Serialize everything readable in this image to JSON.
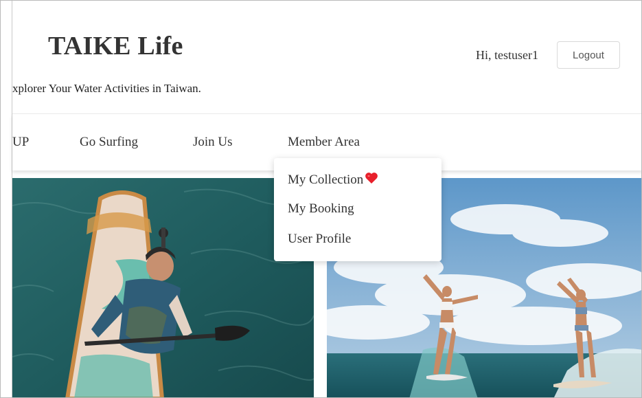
{
  "header": {
    "brand": "TAIKE Life",
    "tagline": "xplorer Your Water Activities in Taiwan.",
    "greeting": "Hi, testuser1",
    "logout_label": "Logout"
  },
  "nav": {
    "items": [
      {
        "label": "UP"
      },
      {
        "label": "Go Surfing"
      },
      {
        "label": "Join Us"
      },
      {
        "label": "Member Area"
      }
    ]
  },
  "member_menu": {
    "items": [
      {
        "label": "My Collection",
        "icon": "heart-icon"
      },
      {
        "label": "My Booking"
      },
      {
        "label": "User Profile"
      }
    ]
  },
  "colors": {
    "text": "#333333",
    "heart": "#e8202b",
    "sea_dark": "#1f5f60",
    "sky": "#9fc3dd"
  }
}
